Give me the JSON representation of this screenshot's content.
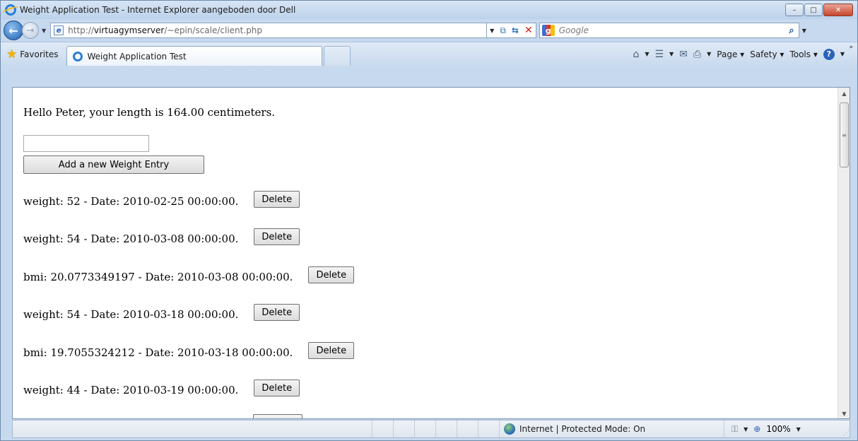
{
  "window": {
    "title": "Weight Application Test - Internet Explorer aangeboden door Dell",
    "buttons": {
      "minimize": "–",
      "maximize": "□",
      "close": "✕"
    }
  },
  "addressbar": {
    "url_prefix": "http://",
    "url_host": "virtuagymserver",
    "url_path": "/~epin/scale/client.php",
    "search_placeholder": "Google"
  },
  "favorites": {
    "label": "Favorites"
  },
  "tabs": [
    {
      "label": "Weight Application Test",
      "active": true
    }
  ],
  "command_bar": {
    "page": "Page",
    "safety": "Safety",
    "tools": "Tools"
  },
  "page": {
    "greeting": "Hello Peter, your length is 164.00 centimeters.",
    "weight_input_value": "",
    "add_button": "Add a new Weight Entry",
    "delete_label": "Delete",
    "entries": [
      "weight: 52 - Date: 2010-02-25 00:00:00.",
      "weight: 54 - Date: 2010-03-08 00:00:00.",
      "bmi: 20.0773349197 - Date: 2010-03-08 00:00:00.",
      "weight: 54 - Date: 2010-03-18 00:00:00.",
      "bmi: 19.7055324212 - Date: 2010-03-18 00:00:00.",
      "weight: 44 - Date: 2010-03-19 00:00:00."
    ]
  },
  "statusbar": {
    "zone": "Internet | Protected Mode: On",
    "zoom": "100%"
  },
  "colors": {
    "frame": "#c7d9ee",
    "ie_blue": "#2a7fd6",
    "close_red": "#c8442c"
  }
}
